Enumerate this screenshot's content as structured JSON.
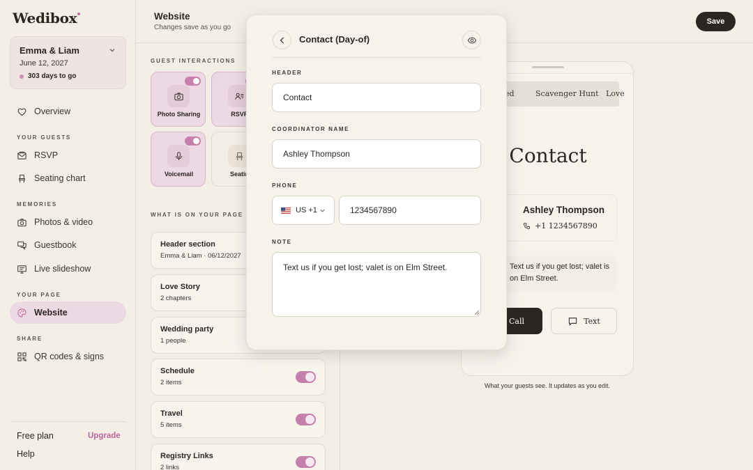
{
  "brand": {
    "logo": "Wedibox",
    "accent": "#c77fac"
  },
  "couple": {
    "name": "Emma & Liam",
    "date": "June 12, 2027",
    "countdown": "303 days to go"
  },
  "nav": {
    "overview": "Overview",
    "section_guests": "YOUR GUESTS",
    "rsvp": "RSVP",
    "seating": "Seating chart",
    "section_memories": "MEMORIES",
    "photos": "Photos & video",
    "guestbook": "Guestbook",
    "slideshow": "Live slideshow",
    "section_page": "YOUR PAGE",
    "website": "Website",
    "section_share": "SHARE",
    "qr": "QR codes & signs",
    "free_plan": "Free plan",
    "upgrade": "Upgrade",
    "help": "Help"
  },
  "header": {
    "title": "Website",
    "subtitle": "Changes save as you go",
    "save": "Save"
  },
  "interactions": {
    "label": "GUEST INTERACTIONS",
    "tiles": [
      {
        "label": "Photo Sharing",
        "icon": "camera-icon",
        "enabled": true
      },
      {
        "label": "RSVP",
        "icon": "guest-list-icon",
        "enabled": true
      },
      {
        "label": "Voicemail",
        "icon": "microphone-icon",
        "enabled": true
      },
      {
        "label": "Seatin",
        "icon": "chair-icon",
        "enabled": false
      }
    ]
  },
  "sections": {
    "label": "WHAT IS ON YOUR PAGE",
    "items": [
      {
        "title": "Header section",
        "sub": "Emma & Liam · 06/12/2027"
      },
      {
        "title": "Love Story",
        "sub": "2 chapters"
      },
      {
        "title": "Wedding party",
        "sub": "1 people"
      },
      {
        "title": "Schedule",
        "sub": "2 items"
      },
      {
        "title": "Travel",
        "sub": "5 items"
      },
      {
        "title": "Registry Links",
        "sub": "2 links"
      }
    ]
  },
  "modal": {
    "title": "Contact (Day-of)",
    "header_label": "HEADER",
    "header_value": "Contact",
    "coordinator_label": "COORDINATOR NAME",
    "coordinator_value": "Ashley Thompson",
    "phone_label": "PHONE",
    "country": "US +1",
    "phone_value": "1234567890",
    "note_label": "NOTE",
    "note_value": "Text us if you get lost; valet is on Elm Street."
  },
  "preview": {
    "tabs": [
      "ed",
      "Scavenger Hunt",
      "Love"
    ],
    "heading": "Contact",
    "coordinator": "Ashley Thompson",
    "phone": "+1 1234567890",
    "note": "Text us if you get lost; valet is on Elm Street.",
    "call": "Call",
    "text": "Text",
    "caption": "What your guests see. It updates as you edit."
  }
}
